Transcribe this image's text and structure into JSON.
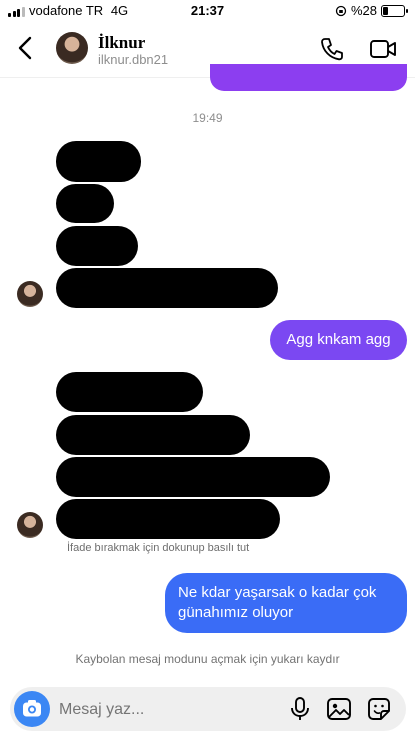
{
  "status_bar": {
    "carrier": "vodafone TR",
    "network": "4G",
    "time": "21:37",
    "battery": "%28"
  },
  "header": {
    "name": "İlknur",
    "username": "ilknur.dbn21"
  },
  "thread": {
    "timestamp": "19:49",
    "outgoing_1": "Agg knkam agg",
    "outgoing_2_line1": "Ne kdar yaşarsak o kadar çok",
    "outgoing_2_line2": "günahımız oluyor",
    "reaction_hint": "İfade bırakmak için dokunup basılı tut",
    "vanish_hint": "Kaybolan mesaj modunu açmak için yukarı kaydır"
  },
  "composer": {
    "placeholder": "Mesaj yaz..."
  },
  "colors": {
    "purple_bubble": "#7b48f2",
    "blue_bubble": "#3a6cf6",
    "camera_button": "#3b87f4"
  },
  "icons": [
    "back-arrow-icon",
    "phone-icon",
    "video-camera-icon",
    "camera-icon",
    "microphone-icon",
    "gallery-icon",
    "sticker-icon",
    "orientation-lock-icon",
    "battery-icon"
  ]
}
